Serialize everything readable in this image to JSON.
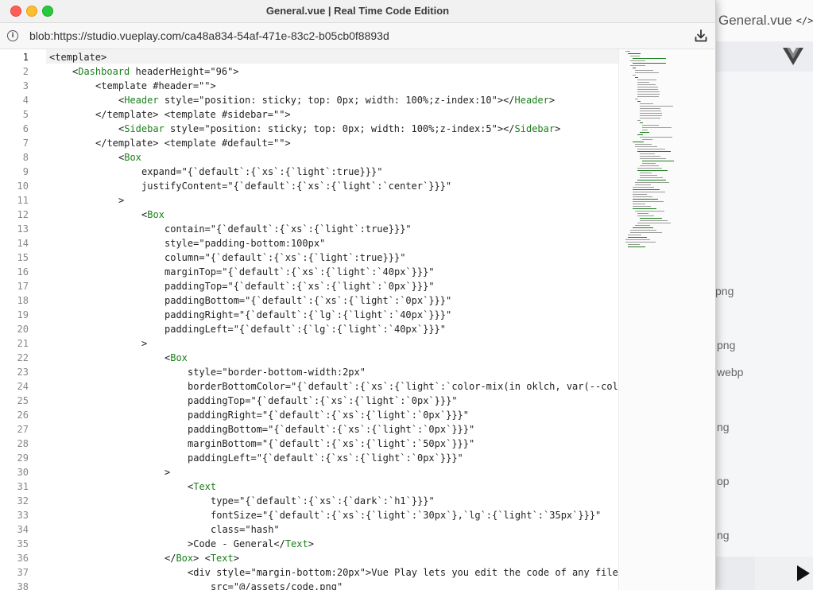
{
  "window": {
    "title": "General.vue | Real Time Code Edition",
    "url": "blob:https://studio.vueplay.com/ca48a834-54af-471e-83c2-b05cb0f8893d"
  },
  "background_app": {
    "title": "General.vue",
    "code_icon": "</>",
    "files": [
      "png",
      "png",
      "webp",
      "ng",
      "op",
      "ng"
    ]
  },
  "icons": {
    "info": "info-icon",
    "download": "download-icon",
    "vue": "vue-logo-icon",
    "play": "play-icon"
  },
  "colors": {
    "tag": "#1a7f1a",
    "close": "#ff5f57",
    "minimize": "#febc2e",
    "maximize": "#28c840"
  },
  "editor": {
    "active_line": 1,
    "lines": [
      {
        "n": "1",
        "indent": 0,
        "pre": "<",
        "tag": "",
        "post": "template>"
      },
      {
        "n": "2",
        "indent": 1,
        "pre": "<",
        "tag": "Dashboard",
        "post": " headerHeight=\"96\">"
      },
      {
        "n": "3",
        "indent": 2,
        "pre": "<template #header=\"\">",
        "tag": "",
        "post": ""
      },
      {
        "n": "4",
        "indent": 3,
        "pre": "<",
        "tag": "Header",
        "post": " style=\"position: sticky; top: 0px; width: 100%;z-index:10\"></",
        "tag2": "Header",
        "post2": ">"
      },
      {
        "n": "5",
        "indent": 2,
        "pre": "</template> <template #sidebar=\"\">",
        "tag": "",
        "post": ""
      },
      {
        "n": "6",
        "indent": 3,
        "pre": "<",
        "tag": "Sidebar",
        "post": " style=\"position: sticky; top: 0px; width: 100%;z-index:5\"></",
        "tag2": "Sidebar",
        "post2": ">"
      },
      {
        "n": "7",
        "indent": 2,
        "pre": "</template> <template #default=\"\">",
        "tag": "",
        "post": ""
      },
      {
        "n": "8",
        "indent": 3,
        "pre": "<",
        "tag": "Box",
        "post": ""
      },
      {
        "n": "9",
        "indent": 4,
        "pre": "expand=\"{`default`:{`xs`:{`light`:true}}}\"",
        "tag": "",
        "post": ""
      },
      {
        "n": "10",
        "indent": 4,
        "pre": "justifyContent=\"{`default`:{`xs`:{`light`:`center`}}}\"",
        "tag": "",
        "post": ""
      },
      {
        "n": "11",
        "indent": 3,
        "pre": ">",
        "tag": "",
        "post": ""
      },
      {
        "n": "12",
        "indent": 4,
        "pre": "<",
        "tag": "Box",
        "post": ""
      },
      {
        "n": "13",
        "indent": 5,
        "pre": "contain=\"{`default`:{`xs`:{`light`:true}}}\"",
        "tag": "",
        "post": ""
      },
      {
        "n": "14",
        "indent": 5,
        "pre": "style=\"padding-bottom:100px\"",
        "tag": "",
        "post": ""
      },
      {
        "n": "15",
        "indent": 5,
        "pre": "column=\"{`default`:{`xs`:{`light`:true}}}\"",
        "tag": "",
        "post": ""
      },
      {
        "n": "16",
        "indent": 5,
        "pre": "marginTop=\"{`default`:{`xs`:{`light`:`40px`}}}\"",
        "tag": "",
        "post": ""
      },
      {
        "n": "17",
        "indent": 5,
        "pre": "paddingTop=\"{`default`:{`xs`:{`light`:`0px`}}}\"",
        "tag": "",
        "post": ""
      },
      {
        "n": "18",
        "indent": 5,
        "pre": "paddingBottom=\"{`default`:{`xs`:{`light`:`0px`}}}\"",
        "tag": "",
        "post": ""
      },
      {
        "n": "19",
        "indent": 5,
        "pre": "paddingRight=\"{`default`:{`lg`:{`light`:`40px`}}}\"",
        "tag": "",
        "post": ""
      },
      {
        "n": "20",
        "indent": 5,
        "pre": "paddingLeft=\"{`default`:{`lg`:{`light`:`40px`}}}\"",
        "tag": "",
        "post": ""
      },
      {
        "n": "21",
        "indent": 4,
        "pre": ">",
        "tag": "",
        "post": ""
      },
      {
        "n": "22",
        "indent": 5,
        "pre": "<",
        "tag": "Box",
        "post": ""
      },
      {
        "n": "23",
        "indent": 6,
        "pre": "style=\"border-bottom-width:2px\"",
        "tag": "",
        "post": ""
      },
      {
        "n": "24",
        "indent": 6,
        "pre": "borderBottomColor=\"{`default`:{`xs`:{`light`:`color-mix(in oklch, var(--color",
        "tag": "",
        "post": ""
      },
      {
        "n": "25",
        "indent": 6,
        "pre": "paddingTop=\"{`default`:{`xs`:{`light`:`0px`}}}\"",
        "tag": "",
        "post": ""
      },
      {
        "n": "26",
        "indent": 6,
        "pre": "paddingRight=\"{`default`:{`xs`:{`light`:`0px`}}}\"",
        "tag": "",
        "post": ""
      },
      {
        "n": "27",
        "indent": 6,
        "pre": "paddingBottom=\"{`default`:{`xs`:{`light`:`0px`}}}\"",
        "tag": "",
        "post": ""
      },
      {
        "n": "28",
        "indent": 6,
        "pre": "marginBottom=\"{`default`:{`xs`:{`light`:`50px`}}}\"",
        "tag": "",
        "post": ""
      },
      {
        "n": "29",
        "indent": 6,
        "pre": "paddingLeft=\"{`default`:{`xs`:{`light`:`0px`}}}\"",
        "tag": "",
        "post": ""
      },
      {
        "n": "30",
        "indent": 5,
        "pre": ">",
        "tag": "",
        "post": ""
      },
      {
        "n": "31",
        "indent": 6,
        "pre": "<",
        "tag": "Text",
        "post": ""
      },
      {
        "n": "32",
        "indent": 7,
        "pre": "type=\"{`default`:{`xs`:{`dark`:`h1`}}}\"",
        "tag": "",
        "post": ""
      },
      {
        "n": "33",
        "indent": 7,
        "pre": "fontSize=\"{`default`:{`xs`:{`light`:`30px`},`lg`:{`light`:`35px`}}}\"",
        "tag": "",
        "post": ""
      },
      {
        "n": "34",
        "indent": 7,
        "pre": "class=\"hash\"",
        "tag": "",
        "post": ""
      },
      {
        "n": "35",
        "indent": 6,
        "pre": ">Code - General</",
        "tag": "Text",
        "post": ">"
      },
      {
        "n": "36",
        "indent": 5,
        "pre": "</",
        "tag": "Box",
        "post": "> <",
        "tag2": "Text",
        "post2": ">"
      },
      {
        "n": "37",
        "indent": 6,
        "pre": "<div style=\"margin-bottom:20px\">Vue Play lets you edit the code of any file",
        "tag": "",
        "post": ""
      },
      {
        "n": "38",
        "indent": 7,
        "pre": "src=\"@/assets/code.png\"",
        "tag": "",
        "post": ""
      }
    ]
  }
}
